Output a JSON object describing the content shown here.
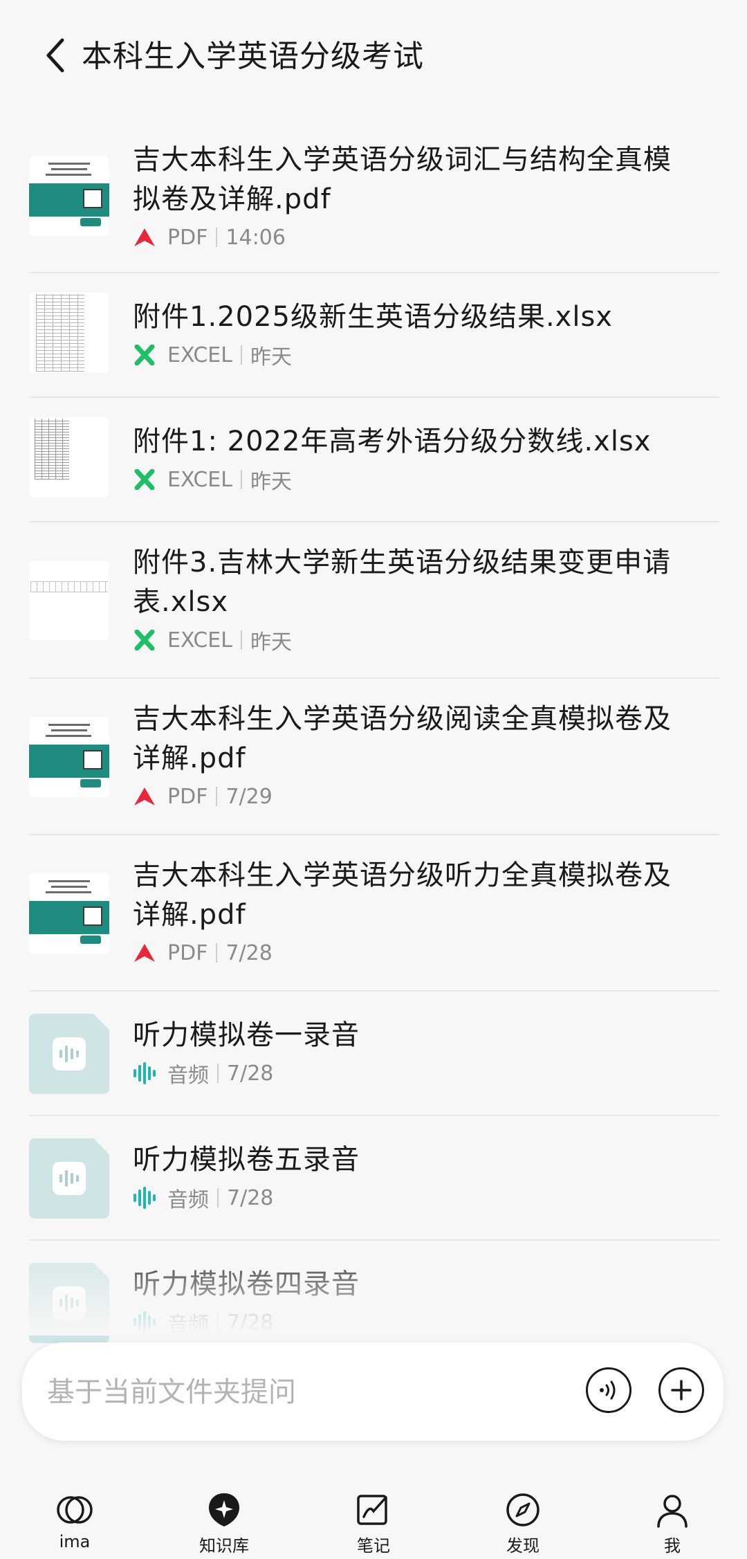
{
  "header": {
    "title": "本科生入学英语分级考试"
  },
  "files": [
    {
      "name": "吉大本科生入学英语分级词汇与结构全真模拟卷及详解.pdf",
      "type": "PDF",
      "time": "14:06",
      "thumb": "pdf-cover"
    },
    {
      "name": "附件1.2025级新生英语分级结果.xlsx",
      "type": "EXCEL",
      "time": "昨天",
      "thumb": "sheet-grid"
    },
    {
      "name": "附件1: 2022年高考外语分级分数线.xlsx",
      "type": "EXCEL",
      "time": "昨天",
      "thumb": "sheet-small"
    },
    {
      "name": "附件3.吉林大学新生英语分级结果变更申请表.xlsx",
      "type": "EXCEL",
      "time": "昨天",
      "thumb": "sheet-form"
    },
    {
      "name": "吉大本科生入学英语分级阅读全真模拟卷及详解.pdf",
      "type": "PDF",
      "time": "7/29",
      "thumb": "pdf-cover"
    },
    {
      "name": "吉大本科生入学英语分级听力全真模拟卷及详解.pdf",
      "type": "PDF",
      "time": "7/28",
      "thumb": "pdf-cover"
    },
    {
      "name": "听力模拟卷一录音",
      "type": "音频",
      "time": "7/28",
      "thumb": "audio"
    },
    {
      "name": "听力模拟卷五录音",
      "type": "音频",
      "time": "7/28",
      "thumb": "audio"
    },
    {
      "name": "听力模拟卷四录音",
      "type": "音频",
      "time": "7/28",
      "thumb": "audio"
    }
  ],
  "ask": {
    "placeholder": "基于当前文件夹提问"
  },
  "nav": [
    {
      "label": "ima",
      "icon": "ima-logo-icon"
    },
    {
      "label": "知识库",
      "icon": "knowledge-base-icon"
    },
    {
      "label": "笔记",
      "icon": "notes-icon"
    },
    {
      "label": "发现",
      "icon": "compass-icon"
    },
    {
      "label": "我",
      "icon": "profile-icon"
    }
  ],
  "colors": {
    "pdf": "#e8283a",
    "excel": "#1fbf6a",
    "audio": "#1fb5b2",
    "cover_band": "#1e8c7f",
    "audio_thumb_bg": "#cfe4e5"
  }
}
